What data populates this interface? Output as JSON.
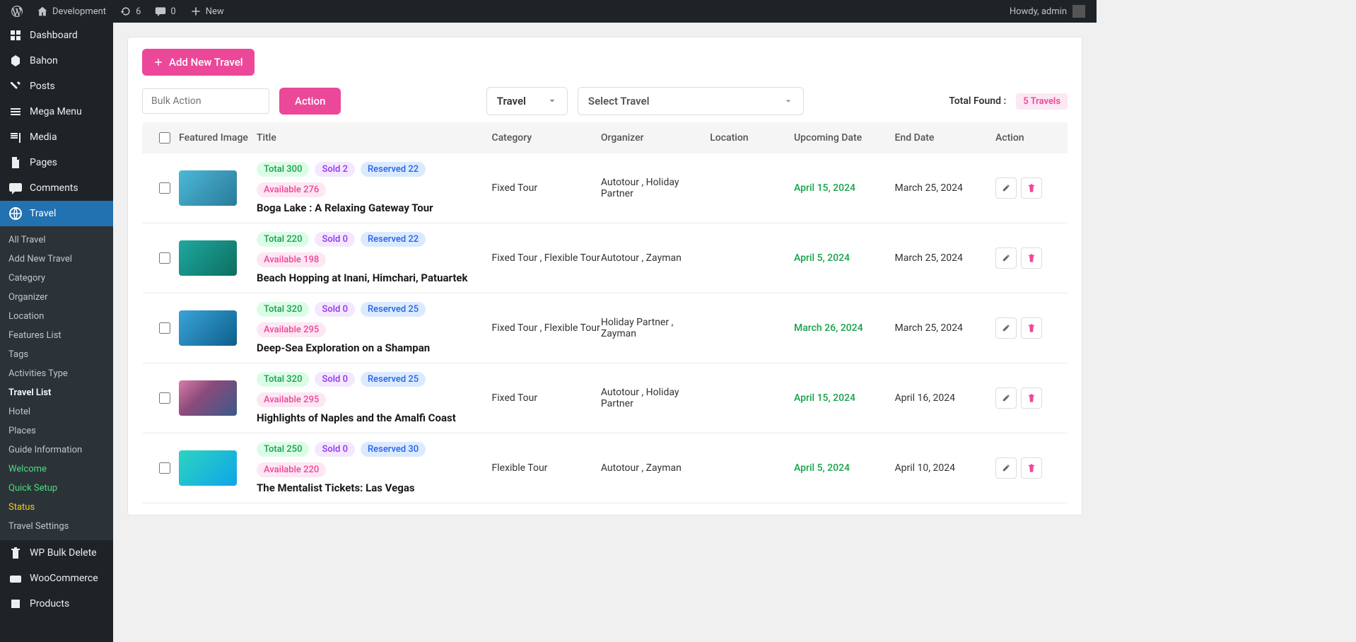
{
  "adminbar": {
    "site": "Development",
    "updates": "6",
    "comments": "0",
    "new": "New",
    "howdy": "Howdy, admin"
  },
  "sidebar": {
    "main": [
      {
        "label": "Dashboard"
      },
      {
        "label": "Bahon"
      },
      {
        "label": "Posts"
      },
      {
        "label": "Mega Menu"
      },
      {
        "label": "Media"
      },
      {
        "label": "Pages"
      },
      {
        "label": "Comments"
      },
      {
        "label": "Travel",
        "current": true
      }
    ],
    "sub": [
      {
        "label": "All Travel"
      },
      {
        "label": "Add New Travel"
      },
      {
        "label": "Category"
      },
      {
        "label": "Organizer"
      },
      {
        "label": "Location"
      },
      {
        "label": "Features List"
      },
      {
        "label": "Tags"
      },
      {
        "label": "Activities Type"
      },
      {
        "label": "Travel List",
        "active": true
      },
      {
        "label": "Hotel"
      },
      {
        "label": "Places"
      },
      {
        "label": "Guide Information"
      },
      {
        "label": "Welcome",
        "cls": "green"
      },
      {
        "label": "Quick Setup",
        "cls": "green"
      },
      {
        "label": "Status",
        "cls": "yellow"
      },
      {
        "label": "Travel Settings"
      }
    ],
    "after": [
      {
        "label": "WP Bulk Delete"
      },
      {
        "label": "WooCommerce"
      },
      {
        "label": "Products"
      }
    ]
  },
  "page": {
    "addNew": "Add New Travel",
    "bulkPlaceholder": "Bulk Action",
    "actionBtn": "Action",
    "travelDrop": "Travel",
    "selectTravel": "Select Travel",
    "totalFound": "Total Found :",
    "totalBadge": "5 Travels"
  },
  "columns": {
    "img": "Featured Image",
    "title": "Title",
    "cat": "Category",
    "org": "Organizer",
    "loc": "Location",
    "up": "Upcoming Date",
    "end": "End Date",
    "act": "Action"
  },
  "rows": [
    {
      "total": "Total 300",
      "sold": "Sold 2",
      "res": "Reserved 22",
      "avail": "Available 276",
      "title": "Boga Lake : A Relaxing Gateway Tour",
      "cat": "Fixed Tour",
      "org": "Autotour , Holiday Partner",
      "loc": "",
      "up": "April 15, 2024",
      "end": "March 25, 2024",
      "thumb": "t1"
    },
    {
      "total": "Total 220",
      "sold": "Sold 0",
      "res": "Reserved 22",
      "avail": "Available 198",
      "title": "Beach Hopping at Inani, Himchari, Patuartek",
      "cat": "Fixed Tour , Flexible Tour",
      "org": "Autotour , Zayman",
      "loc": "",
      "up": "April 5, 2024",
      "end": "March 25, 2024",
      "thumb": "t2"
    },
    {
      "total": "Total 320",
      "sold": "Sold 0",
      "res": "Reserved 25",
      "avail": "Available 295",
      "title": "Deep-Sea Exploration on a Shampan",
      "cat": "Fixed Tour , Flexible Tour",
      "org": "Holiday Partner , Zayman",
      "loc": "",
      "up": "March 26, 2024",
      "end": "March 25, 2024",
      "thumb": "t3"
    },
    {
      "total": "Total 320",
      "sold": "Sold 0",
      "res": "Reserved 25",
      "avail": "Available 295",
      "title": "Highlights of Naples and the Amalfi Coast",
      "cat": "Fixed Tour",
      "org": "Autotour , Holiday Partner",
      "loc": "",
      "up": "April 15, 2024",
      "end": "April 16, 2024",
      "thumb": "t4"
    },
    {
      "total": "Total 250",
      "sold": "Sold 0",
      "res": "Reserved 30",
      "avail": "Available 220",
      "title": "The Mentalist Tickets: Las Vegas",
      "cat": "Flexible Tour",
      "org": "Autotour , Zayman",
      "loc": "",
      "up": "April 5, 2024",
      "end": "April 10, 2024",
      "thumb": "t5"
    }
  ]
}
